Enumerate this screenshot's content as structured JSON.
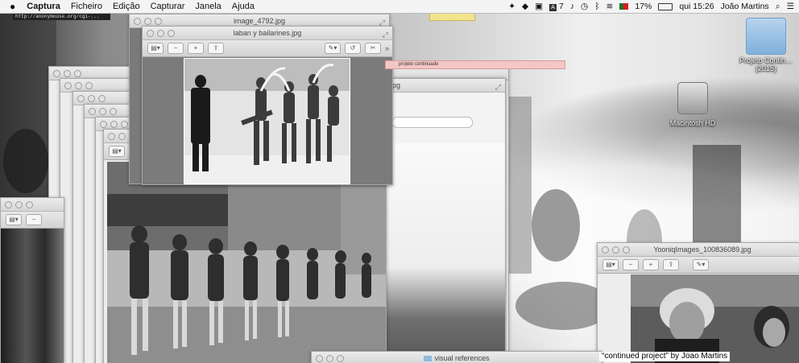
{
  "menubar": {
    "app": "Captura",
    "items": [
      "Ficheiro",
      "Edição",
      "Capturar",
      "Janela",
      "Ajuda"
    ],
    "status": {
      "notification_count": "7",
      "battery": "17%",
      "clock": "qui 15:26",
      "user": "João Martins"
    }
  },
  "url_strip": "http://anonymouse.org/cgi-...",
  "pink_bar": "projeto continuado",
  "windows": {
    "image_4792": {
      "title": "image_4792.jpg"
    },
    "laban": {
      "title": "laban y bailarines.jpg"
    },
    "partial_title": "jpg",
    "yooniq": {
      "title": "YooniqImages_100836089.jpg"
    },
    "finder": {
      "title": "visual references"
    }
  },
  "desktop": {
    "folder_label": "Projeto Contin…(2015)",
    "drive_label": "Macintosh HD"
  },
  "caption": "“continued project” by Joao Martins",
  "colors": {
    "menubar": "#f4f4f4",
    "pink": "#f4c6c6",
    "folder": "#8fb9e0"
  }
}
